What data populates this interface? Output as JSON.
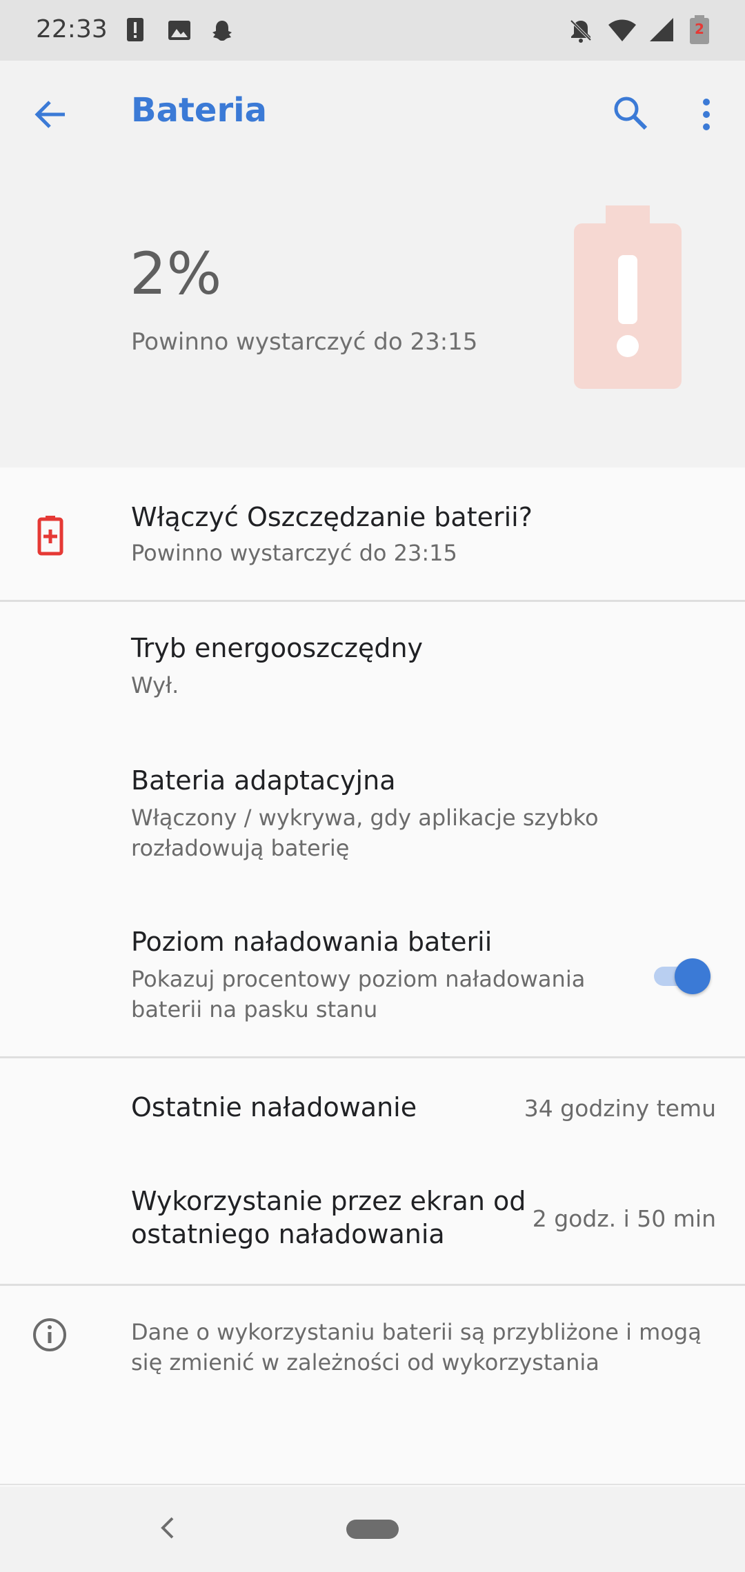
{
  "status_bar": {
    "time": "22:33",
    "left_icons": [
      "alert-icon",
      "image-icon",
      "snapchat-icon"
    ],
    "right_icons": [
      "notifications-off-icon",
      "wifi-icon",
      "signal-icon",
      "battery-low-icon"
    ],
    "battery_badge": "2"
  },
  "toolbar": {
    "title": "Bateria",
    "icons": [
      "back-arrow-icon",
      "search-icon",
      "more-vert-icon"
    ]
  },
  "header": {
    "level": "2%",
    "estimate": "Powinno wystarczyć do 23:15",
    "icon": "battery-alert-icon",
    "accent_color": "#f6d8d2"
  },
  "saver_prompt": {
    "title": "Włączyć Oszczędzanie baterii?",
    "subtitle": "Powinno wystarczyć do 23:15",
    "icon": "battery-plus-icon",
    "icon_color": "#e53935"
  },
  "settings": [
    {
      "title": "Tryb energooszczędny",
      "subtitle": "Wył."
    },
    {
      "title": "Bateria adaptacyjna",
      "subtitle_lines": [
        "Włączony / wykrywa, gdy aplikacje szybko",
        "rozładowują baterię"
      ]
    },
    {
      "title": "Poziom naładowania baterii",
      "subtitle_lines": [
        "Pokazuj procentowy poziom naładowania",
        "baterii na pasku stanu"
      ],
      "toggle": true
    }
  ],
  "stats": [
    {
      "label": "Ostatnie naładowanie",
      "value": "34 godziny temu"
    },
    {
      "label_lines": [
        "Wykorzystanie przez ekran od",
        "ostatniego naładowania"
      ],
      "value": "2 godz. i 50 min"
    }
  ],
  "footer": {
    "icon": "info-icon",
    "lines": [
      "Dane o wykorzystaniu baterii są przybliżone i mogą",
      "się zmienić w zależności od wykorzystania"
    ]
  },
  "nav": {
    "icons": [
      "nav-back-icon",
      "nav-home-pill"
    ]
  },
  "colors": {
    "accent": "#3b7ad6",
    "warning": "#e53935"
  }
}
